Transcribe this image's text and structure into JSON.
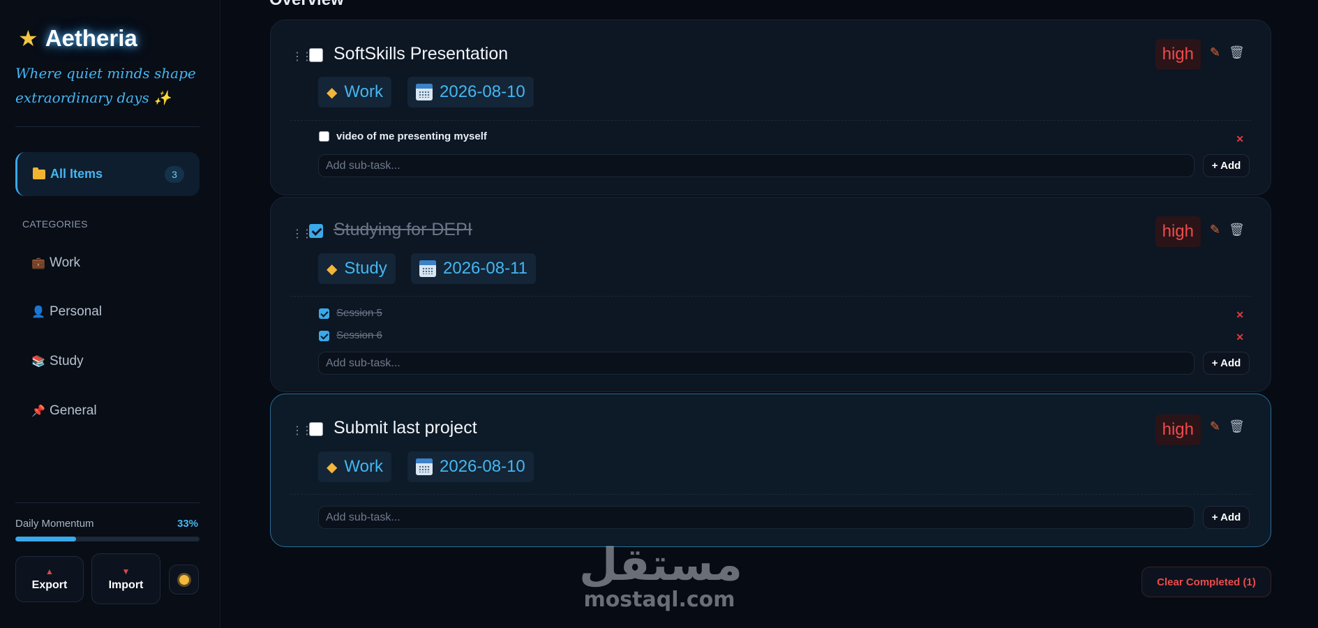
{
  "brand": {
    "name": "Aetheria",
    "icon": "star-icon",
    "tagline": "Where quiet minds shape extraordinary days ✨"
  },
  "nav": {
    "all_label": "All Items",
    "all_count": "3"
  },
  "categories": {
    "title": "CATEGORIES",
    "items": [
      {
        "label": "Work",
        "icon": "💼"
      },
      {
        "label": "Personal",
        "icon": "👤"
      },
      {
        "label": "Study",
        "icon": "📚"
      },
      {
        "label": "General",
        "icon": "📌"
      }
    ]
  },
  "momentum": {
    "label": "Daily Momentum",
    "percent_text": "33%",
    "fraction": 0.33
  },
  "buttons": {
    "export": "Export",
    "import": "Import",
    "add": "+ Add",
    "clear": "Clear Completed (1)"
  },
  "main": {
    "title": "Overview"
  },
  "tasks": [
    {
      "title": "SoftSkills Presentation",
      "done": false,
      "priority": "high",
      "category": "Work",
      "date": "2026-08-10",
      "subtasks": [
        {
          "text": "video of me presenting myself",
          "done": false
        }
      ],
      "subtask_placeholder": "Add sub-task..."
    },
    {
      "title": "Studying for DEPI",
      "done": true,
      "priority": "high",
      "category": "Study",
      "date": "2026-08-11",
      "subtasks": [
        {
          "text": "Session 5",
          "done": true
        },
        {
          "text": "Session 6",
          "done": true
        }
      ],
      "subtask_placeholder": "Add sub-task..."
    },
    {
      "title": "Submit last project",
      "done": false,
      "priority": "high",
      "category": "Work",
      "date": "2026-08-10",
      "subtasks": [],
      "subtask_placeholder": "Add sub-task..."
    }
  ],
  "watermark": {
    "arabic": "مستقل",
    "latin": "mostaql.com"
  },
  "colors": {
    "accent": "#3aa9ea",
    "danger": "#ef4b4b",
    "background": "#070b13"
  }
}
